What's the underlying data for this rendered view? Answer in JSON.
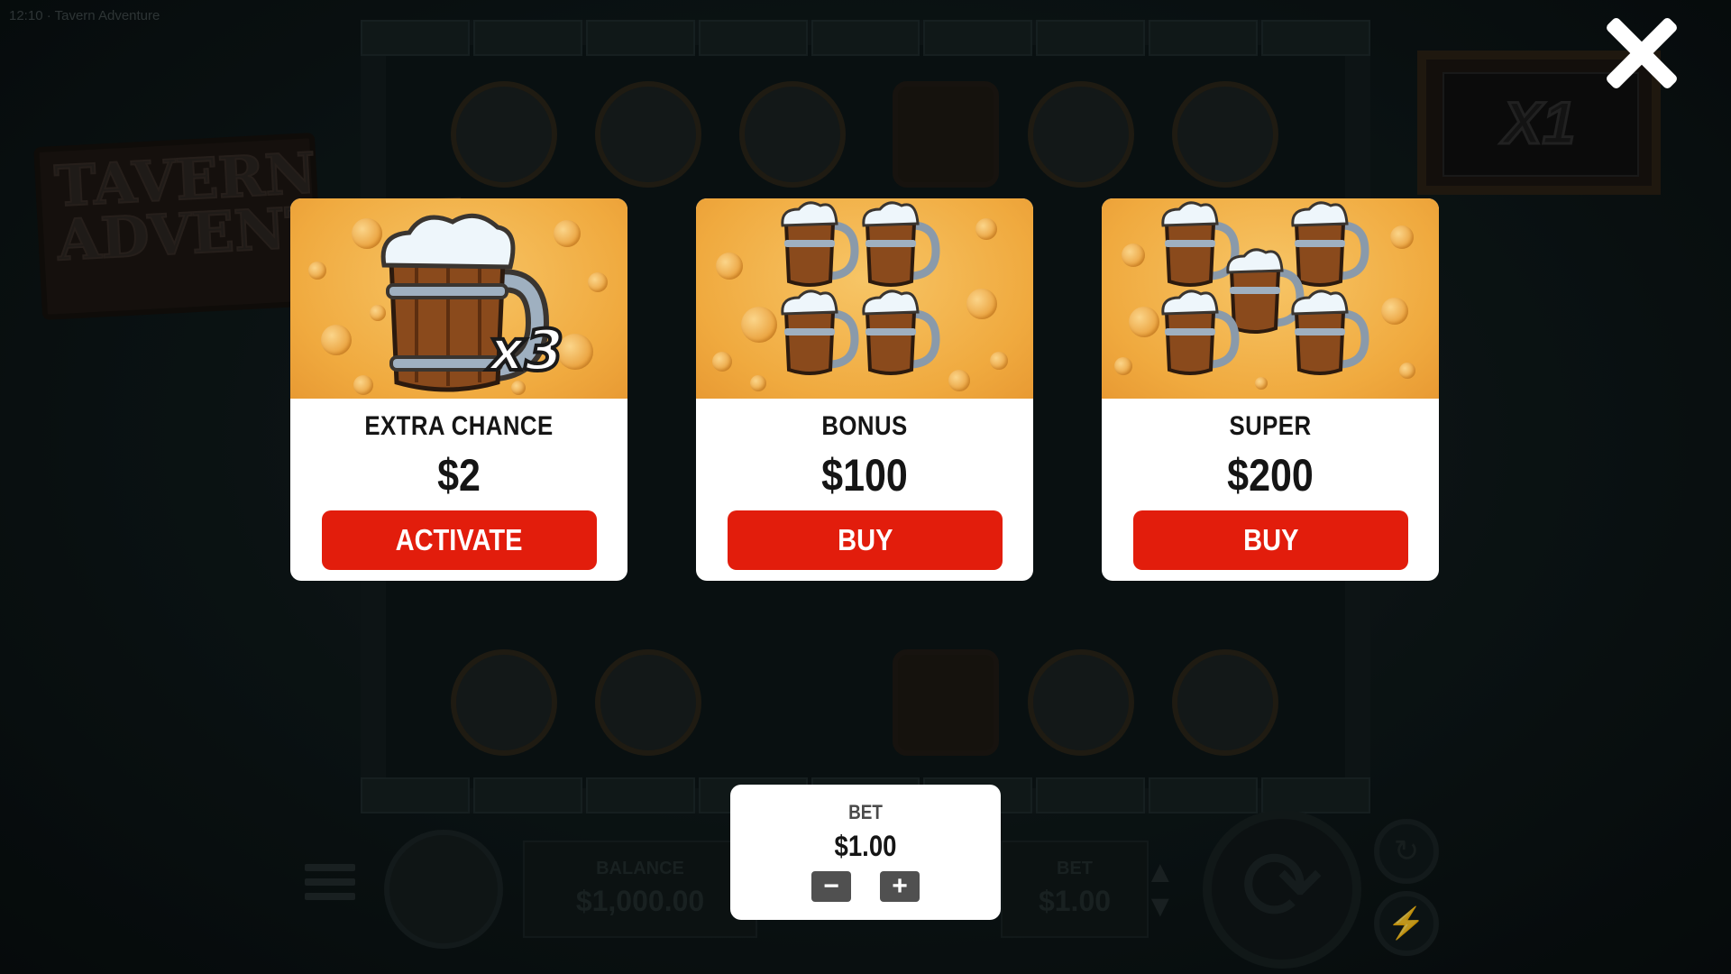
{
  "status": {
    "time": "12:10",
    "game_title": "Tavern Adventure"
  },
  "background": {
    "logo_text": "TAVERN ADVENTURE",
    "multiplier": "X1",
    "balance_label": "BALANCE",
    "balance_value": "$1,000.00",
    "bet_label": "BET",
    "bet_value": "$1.00"
  },
  "cards": [
    {
      "title": "EXTRA CHANCE",
      "price": "$2",
      "button": "ACTIVATE",
      "badge": "x3",
      "image": "single-mug-x3-icon"
    },
    {
      "title": "BONUS",
      "price": "$100",
      "button": "BUY",
      "image": "four-mugs-icon"
    },
    {
      "title": "SUPER",
      "price": "$200",
      "button": "BUY",
      "image": "five-mugs-icon"
    }
  ],
  "bet_panel": {
    "label": "BET",
    "value": "$1.00",
    "minus": "−",
    "plus": "+"
  },
  "colors": {
    "button_red": "#e21d0c",
    "card_bg": "#f0aa3f",
    "panel_white": "#ffffff",
    "backdrop": "#0c1516"
  }
}
